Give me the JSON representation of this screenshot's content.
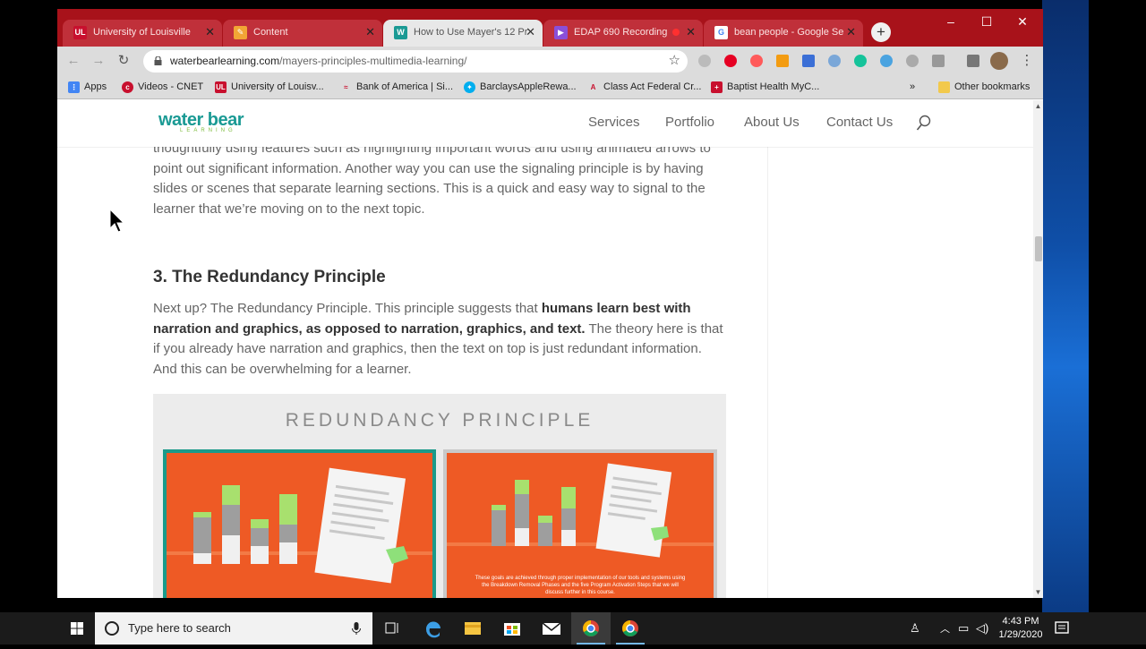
{
  "browser": {
    "tabs": [
      {
        "title": "University of Louisville",
        "icon": "UL",
        "color": "#c8102e",
        "active": false
      },
      {
        "title": "Content",
        "icon": "pencil",
        "color": "#f2a535",
        "active": false
      },
      {
        "title": "How to Use Mayer's 12 Pr",
        "icon": "W",
        "color": "#1a9a94",
        "active": true
      },
      {
        "title": "EDAP 690 Recording",
        "icon": "play",
        "color": "#8a4fd8",
        "active": false
      },
      {
        "title": "bean people - Google Se",
        "icon": "G",
        "color": "#4285f4",
        "active": false
      }
    ],
    "new_tab": "+",
    "window_controls": {
      "minimize": "–",
      "maximize": "☐",
      "close": "✕"
    },
    "url_domain": "waterbearlearning.com",
    "url_path": "/mayers-principles-multimedia-learning/",
    "bookmark_star": "☆",
    "bookmarks": [
      {
        "label": "Apps",
        "icon": "apps",
        "color": "#4285f4"
      },
      {
        "label": "Videos - CNET",
        "icon": "cnet",
        "color": "#c8102e"
      },
      {
        "label": "University of Louisv...",
        "icon": "UL",
        "color": "#c8102e"
      },
      {
        "label": "Bank of America | Si...",
        "icon": "boa",
        "color": "#c8102e"
      },
      {
        "label": "BarclaysAppleRewa...",
        "icon": "barclays",
        "color": "#00aeef"
      },
      {
        "label": "Class Act Federal Cr...",
        "icon": "ca",
        "color": "#c8102e"
      },
      {
        "label": "Baptist Health MyC...",
        "icon": "bh",
        "color": "#c8102e"
      }
    ],
    "bookmarks_overflow": "»",
    "other_bookmarks": "Other bookmarks"
  },
  "site": {
    "logo_main": "water bear",
    "logo_sub": "LEARNING",
    "nav": [
      "Services",
      "Portfolio",
      "About Us",
      "Contact Us"
    ]
  },
  "article": {
    "para1": "thoughtfully using features such as highlighting important words and using animated arrows to point out significant information. Another way you can use the signaling principle is by having slides or scenes that separate learning sections. This is a quick and easy way to signal to the learner that we’re moving on to the next topic.",
    "heading": "3. The Redundancy Principle",
    "para2_start": "Next up? The Redundancy Principle. This principle suggests that ",
    "para2_bold": "humans learn best with narration and graphics, as opposed to narration, graphics, and text.",
    "para2_end": " The theory here is that if you already have narration and graphics, then the text on top is just redundant information. And this can be overwhelming for a learner.",
    "figure_title": "REDUNDANCY PRINCIPLE",
    "figure_caption": "These goals are achieved through proper implementation of our tools and systems using the Breakdown Removal Phases and the five Program Activation Steps that we will discuss further in this course."
  },
  "taskbar": {
    "search_placeholder": "Type here to search",
    "time": "4:43 PM",
    "date": "1/29/2020"
  },
  "colors": {
    "chrome_red": "#a8121a",
    "brand_teal": "#1a9a94",
    "panel_orange": "#ee5a25"
  }
}
